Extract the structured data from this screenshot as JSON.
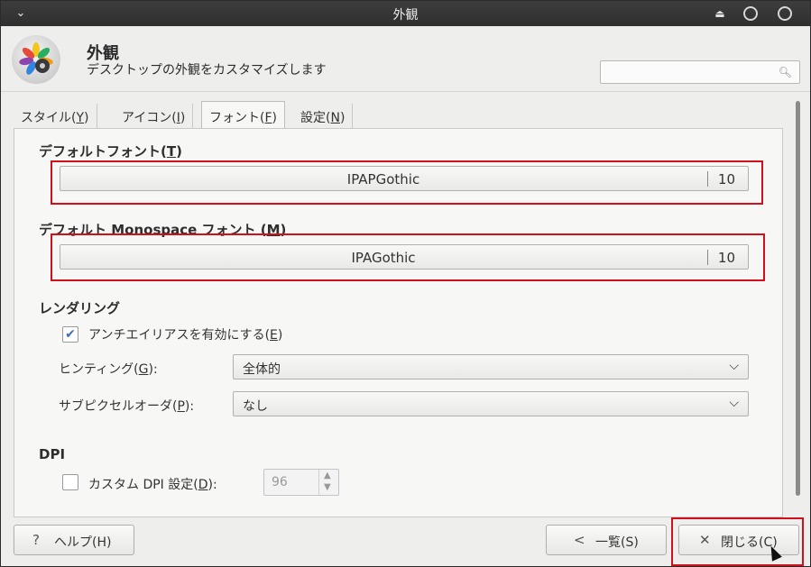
{
  "window": {
    "title": "外観",
    "menu_icon": "chevron-down-icon",
    "controls": [
      "eject-icon",
      "minimize-icon",
      "close-icon"
    ]
  },
  "header": {
    "title": "外観",
    "subtitle": "デスクトップの外観をカスタマイズします",
    "search": {
      "value": "",
      "placeholder": ""
    }
  },
  "tabs": [
    {
      "label": "スタイル(",
      "key": "Y",
      "suffix": ")",
      "active": false
    },
    {
      "label": "アイコン(",
      "key": "I",
      "suffix": ")",
      "active": false
    },
    {
      "label": "フォント(",
      "key": "F",
      "suffix": ")",
      "active": true
    },
    {
      "label": "設定(",
      "key": "N",
      "suffix": ")",
      "active": false
    }
  ],
  "fonts": {
    "default_label": "デフォルトフォント(",
    "default_key": "T",
    "default_suffix": ")",
    "default_font_name": "IPAPGothic",
    "default_font_size": "10",
    "mono_label": "デフォルト Monospace フォント (",
    "mono_key": "M",
    "mono_suffix": ")",
    "mono_font_name": "IPAGothic",
    "mono_font_size": "10"
  },
  "rendering": {
    "section": "レンダリング",
    "antialias_label": "アンチエイリアスを有効にする(",
    "antialias_key": "E",
    "antialias_suffix": ")",
    "antialias_checked": true,
    "hinting_label": "ヒンティング(",
    "hinting_key": "G",
    "hinting_suffix": "):",
    "hinting_value": "全体的",
    "subpixel_label": "サブピクセルオーダ(",
    "subpixel_key": "P",
    "subpixel_suffix": "):",
    "subpixel_value": "なし"
  },
  "dpi": {
    "section": "DPI",
    "custom_label": "カスタム DPI 設定(",
    "custom_key": "D",
    "custom_suffix": "):",
    "custom_checked": false,
    "value": "96"
  },
  "footer": {
    "help_icon": "?",
    "help_label": "ヘルプ(H)",
    "overview_icon": "<",
    "overview_label": "一覧(S)",
    "close_icon": "✕",
    "close_label": "閉じる(C)"
  },
  "colors": {
    "highlight": "#d0101a",
    "titlebar": "#333333",
    "check_accent": "#3b6fb6"
  }
}
